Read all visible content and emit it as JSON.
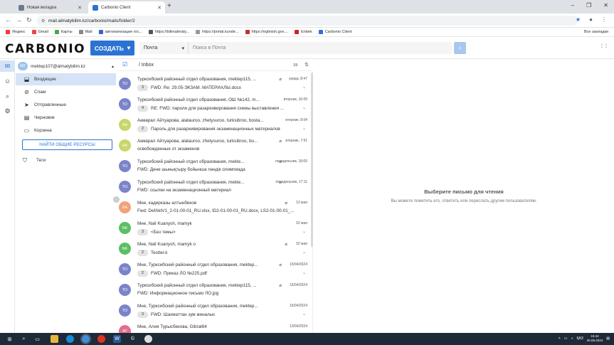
{
  "browser": {
    "tabs": [
      {
        "label": "Новая вкладка",
        "active": false
      },
      {
        "label": "Carbonio Client",
        "active": true
      }
    ],
    "url": "mail.almatybilim.kz/carbonio/mails/folder/2",
    "bookmarks": [
      "Яндекс",
      "Gmail",
      "Карты",
      "Mail",
      "автоматизация гос...",
      "https://bilimalmaty...",
      "https://portal.kunde...",
      "https://egtinish.gov....",
      "Enbek",
      "Carbonio Client"
    ],
    "bookmarks_all": "Все закладки"
  },
  "app": {
    "logo": "CARBONIO",
    "create_label": "СОЗДАТЬ",
    "search_scope": "Почта",
    "search_placeholder": "Поиск в Почта"
  },
  "sidebar": {
    "account_initials": "МZ",
    "account": "mektep107@almatybilim.kz",
    "folders": [
      {
        "label": "Входящие",
        "icon": "inbox-icon",
        "active": true
      },
      {
        "label": "Спам",
        "icon": "spam-icon",
        "active": false
      },
      {
        "label": "Отправленные",
        "icon": "send-icon",
        "active": false
      },
      {
        "label": "Черновик",
        "icon": "draft-icon",
        "active": false
      },
      {
        "label": "Корзина",
        "icon": "trash-icon",
        "active": false
      }
    ],
    "shared_button": "НАЙТИ ОБЩИЕ РЕСУРСЫ",
    "tags": "Теги"
  },
  "list": {
    "title": "/ Inbox",
    "count": "19",
    "messages": [
      {
        "initials": "ТО",
        "color": "#7b83c9",
        "from": "Турксибский районный отдел образования, mektep115, ...",
        "date": "среда, 8:47",
        "count": "3",
        "subject": "FWD: Re: 29.05-ЭКЗАМ. МАТЕРИАЛЫ.docx",
        "attach": true
      },
      {
        "initials": "ТО",
        "color": "#7b83c9",
        "from": "Турксибский районный отдел образования, ОШ №142, m...",
        "date": "вторник, 16:09",
        "count": "4",
        "subject": "RE: FWD: пароли для разархивирования схемы выставления ...",
        "attach": false
      },
      {
        "initials": "АА",
        "color": "#c9d66a",
        "from": "Акмарал Айтуарова, alatauroo, zhetysuroo, turksibroo, bosta...",
        "date": "вторник, 8:04",
        "count": "2",
        "subject": "Пароль для разархивирования экзаменационных материалов",
        "attach": false
      },
      {
        "initials": "АА",
        "color": "#c9d66a",
        "from": "Акмарал Айтуарова, alatauroo, zhetysuroo, turksibroo, bo...",
        "date": "вторник, 7:51",
        "count": "",
        "subject": "освобожденные от экзаменов",
        "attach": true
      },
      {
        "initials": "ТО",
        "color": "#7b83c9",
        "from": "Турксибский районный отдел образования, mekte...",
        "date": "понедельник, 18:00",
        "count": "",
        "subject": "FWD: Дене шынықтыру бойынша пәндік олимпиада",
        "attach": true
      },
      {
        "initials": "ТО",
        "color": "#7b83c9",
        "from": "Турксибский районный отдел образования, mekte...",
        "date": "понедельник, 17:11",
        "count": "",
        "subject": "FWD: ссылки на экзаменационный материал",
        "attach": true
      },
      {
        "initials": "КА",
        "color": "#f0a278",
        "from": "Мне, кадирказы алтынбеков",
        "date": "13 мая",
        "count": "",
        "subject": "Fwd: DefAktV1_2-01-00-01_RU.xlsx, ID2-01-00-01_RU.docx, LS2-01-00-01_...",
        "attach": true
      },
      {
        "initials": "NK",
        "color": "#5cbf62",
        "from": "Мне, Nail Kuanysh, mamyk",
        "date": "02 мая",
        "count": "3",
        "subject": "<Без темы>",
        "attach": false
      },
      {
        "initials": "NK",
        "color": "#5cbf62",
        "from": "Мне, Nail Kuanysh, mamyk о",
        "date": "02 мая",
        "count": "2",
        "subject": "Testter.k",
        "attach": true
      },
      {
        "initials": "ТО",
        "color": "#7b83c9",
        "from": "Мне, Турксибский районный отдел образования, mektep...",
        "date": "15/04/2024",
        "count": "2",
        "subject": "FWD: Приказ ЛО №225.pdf",
        "attach": true
      },
      {
        "initials": "ТО",
        "color": "#7b83c9",
        "from": "Турксибский районный отдел образования, mektep115, ...",
        "date": "15/04/2024",
        "count": "",
        "subject": "FWD: Информационное письмо ЛО.jpg",
        "attach": true
      },
      {
        "initials": "ТО",
        "color": "#7b83c9",
        "from": "Мне, Турксибский районный отдел образования, mektep...",
        "date": "15/04/2024",
        "count": "3",
        "subject": "FWD: Шахматтан зум жиналыс",
        "attach": false
      },
      {
        "initials": "АТ",
        "color": "#e46d8d",
        "from": "Мне, Алия Турысбекова, Gibrat64",
        "date": "13/04/2024",
        "count": "",
        "subject": "",
        "attach": false
      }
    ]
  },
  "reader": {
    "title": "Выберите письмо для чтения",
    "subtitle": "Вы можете пометить его, ответить или переслать другим пользователям."
  },
  "taskbar": {
    "lang": "ҚАЗ",
    "time": "15:44",
    "date": "30.05.2024"
  }
}
